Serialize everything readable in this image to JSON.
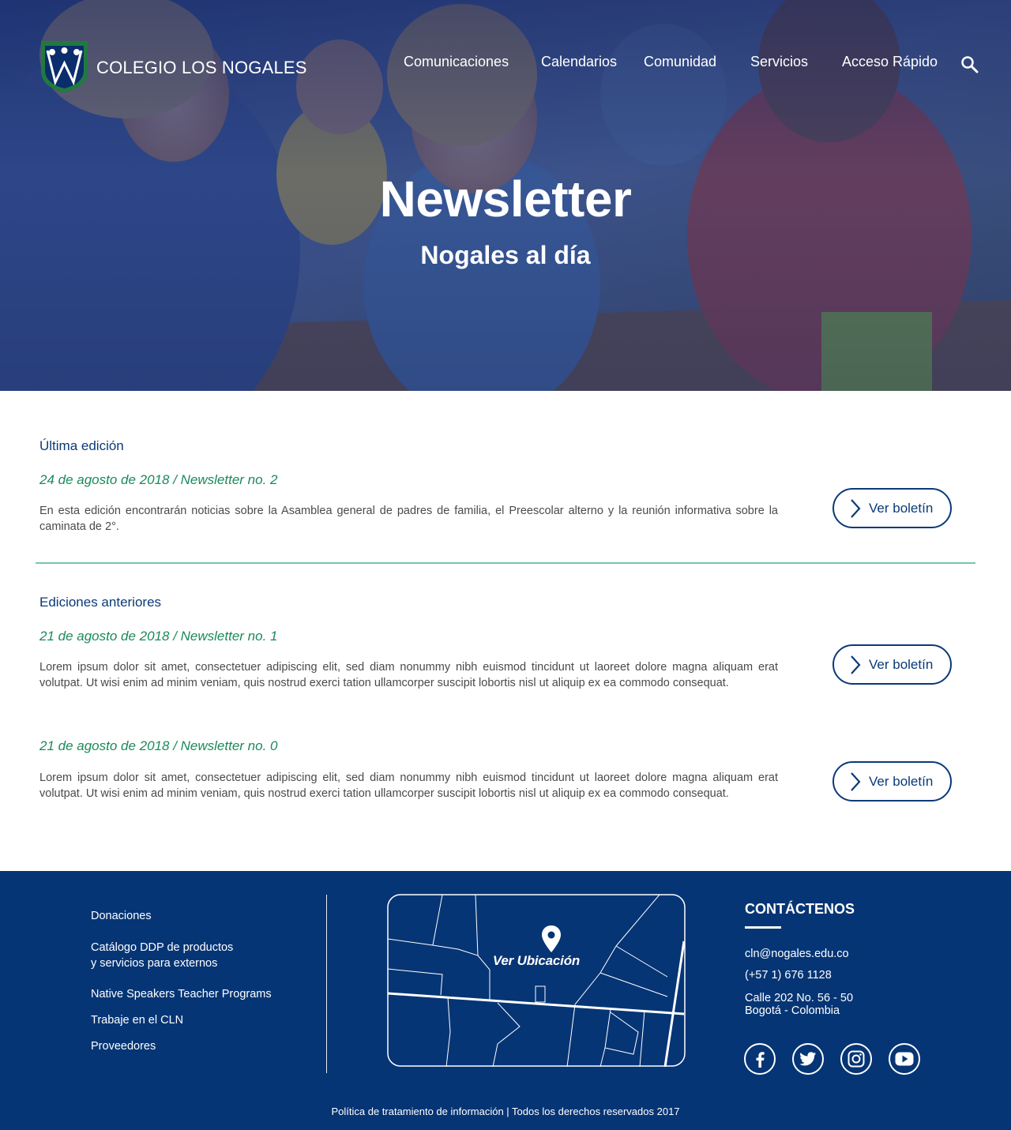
{
  "brand": {
    "name": "COLEGIO LOS NOGALES"
  },
  "nav": {
    "items": [
      {
        "label": "Comunicaciones"
      },
      {
        "label": "Calendarios"
      },
      {
        "label": "Comunidad"
      },
      {
        "label": "Servicios"
      },
      {
        "label": "Acceso Rápido"
      }
    ],
    "search_icon": "search-icon"
  },
  "hero": {
    "title": "Newsletter",
    "subtitle": "Nogales al día"
  },
  "latest": {
    "heading": "Última edición",
    "entry": {
      "date_title": "24 de agosto de 2018 / Newsletter no. 2",
      "description": "En esta edición encontrarán noticias sobre la Asamblea general de padres de familia, el Preescolar alterno y la reunión informativa sobre la caminata de 2°.",
      "button_label": "Ver boletín"
    }
  },
  "previous": {
    "heading": "Ediciones anteriores",
    "entries": [
      {
        "date_title": "21 de agosto de 2018 / Newsletter no. 1",
        "description": "Lorem ipsum dolor sit amet, consectetuer adipiscing elit, sed diam nonummy nibh euismod tincidunt ut laoreet dolore magna aliquam erat volutpat. Ut wisi enim ad minim veniam, quis nostrud exerci tation ullamcorper suscipit lobortis nisl ut aliquip ex ea commodo consequat.",
        "button_label": "Ver boletín"
      },
      {
        "date_title": "21 de agosto de 2018 / Newsletter no. 0",
        "description": "Lorem ipsum dolor sit amet, consectetuer adipiscing elit, sed diam nonummy nibh euismod tincidunt ut laoreet dolore magna aliquam erat volutpat. Ut wisi enim ad minim veniam, quis nostrud exerci tation ullamcorper suscipit lobortis nisl ut aliquip ex ea commodo consequat.",
        "button_label": "Ver boletín"
      }
    ]
  },
  "footer": {
    "links": [
      {
        "label": "Donaciones"
      },
      {
        "label": "Catálogo DDP de productos",
        "label2": "y servicios para externos"
      },
      {
        "label": "Native Speakers Teacher Programs"
      },
      {
        "label": "Trabaje en el CLN"
      },
      {
        "label": "Proveedores"
      }
    ],
    "map_label": "Ver Ubicación",
    "contact": {
      "title": "CONTÁCTENOS",
      "email": "cln@nogales.edu.co",
      "phone": "(+57 1) 676 1128",
      "address_line1": "Calle 202 No. 56 - 50",
      "address_line2": "Bogotá - Colombia"
    },
    "social": [
      "facebook-icon",
      "twitter-icon",
      "instagram-icon",
      "youtube-icon"
    ],
    "legal": "Política de tratamiento de información | Todos los derechos reservados 2017"
  },
  "colors": {
    "navy": "#0a3a78",
    "footer_bg": "#063575",
    "green_date": "#1b8a5a",
    "divider": "#7bc4ac",
    "logo_green": "#1f7a3f"
  }
}
